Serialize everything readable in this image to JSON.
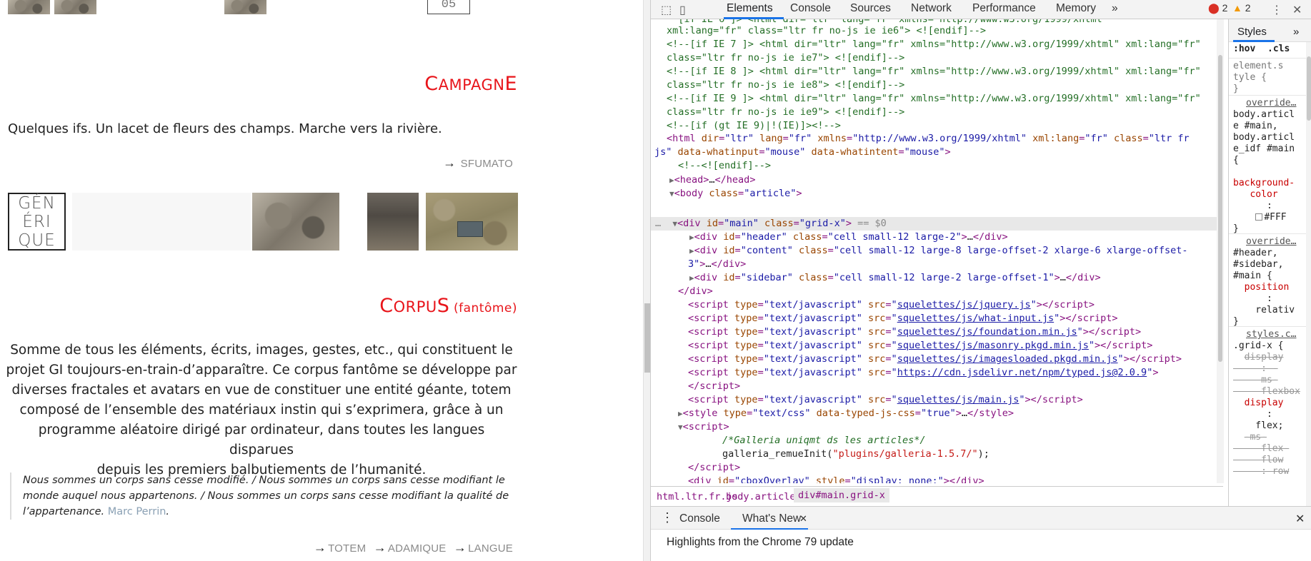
{
  "page": {
    "top_number": "05",
    "campagne": {
      "title_first": "C",
      "title_mid": "ampagn",
      "title_last": "E",
      "text": "Quelques ifs. Un lacet de fleurs des champs. Marche vers la rivière.",
      "links": [
        "SFUMATO"
      ]
    },
    "generique": {
      "line1": "GÉN",
      "line2": "ÉRI",
      "line3": "QUE"
    },
    "corpus": {
      "title_first": "C",
      "title_mid": "orpu",
      "title_last": "S",
      "title_sub": "(fantôme)",
      "paragraph": [
        "Somme de tous les éléments, écrits, images, gestes, etc., qui constituent le",
        "projet GI toujours-en-train-d’apparaître. Ce corpus fantôme se développe par",
        "diverses fractales et avatars en vue de constituer une entité géante, totem",
        "composé de l’ensemble des matériaux instin qui s’exprimera, grâce à un",
        "programme aléatoire dirigé par ordinateur, dans toutes les langues disparues",
        "depuis les premiers balbutiements de l’humanité."
      ],
      "quote": "Nous sommes un corps sans cesse modifié. / Nous sommes un corps sans cesse modifiant le monde auquel nous appartenons. / Nous sommes un corps sans cesse modifiant la qualité de l’appartenance.",
      "quote_author": "Marc Perrin",
      "quote_end": ".",
      "links": [
        "TOTEM",
        "ADAMIQUE",
        "LANGUE"
      ]
    }
  },
  "devtools": {
    "tabs": [
      "Elements",
      "Console",
      "Sources",
      "Network",
      "Performance",
      "Memory"
    ],
    "more_tabs": "»",
    "errors": "2",
    "warnings": "2",
    "breadcrumbs": [
      "html.ltr.fr.js",
      "body.article",
      "div#main.grid-x"
    ],
    "styles_tab": "Styles",
    "styles_more": "»",
    "hov": ":hov",
    "cls": ".cls",
    "drawer_tabs": [
      "Console",
      "What's New"
    ],
    "drawer_text": "Highlights from the Chrome 79 update",
    "accent": "#1a73e8"
  }
}
